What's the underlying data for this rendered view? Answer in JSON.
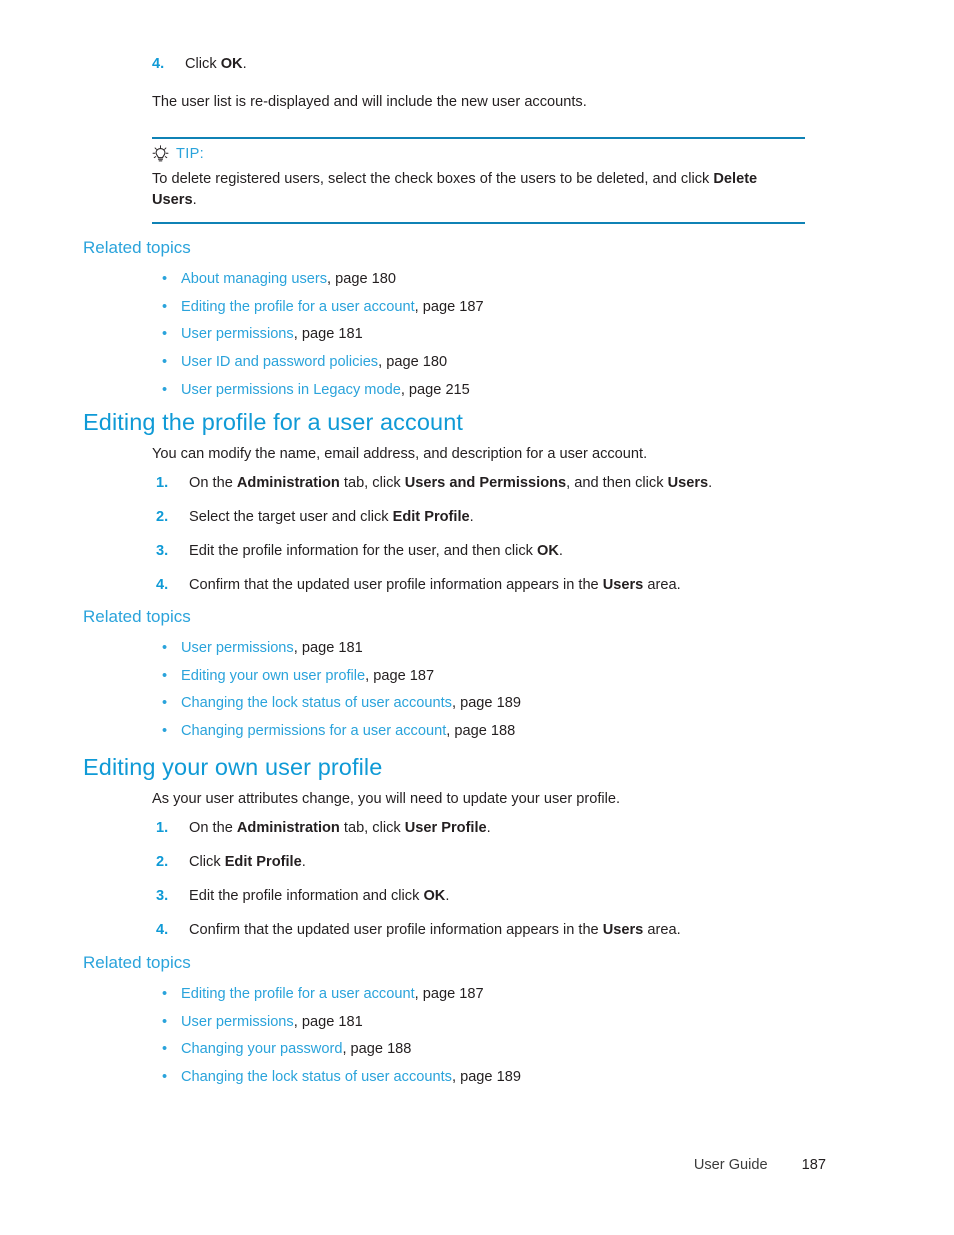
{
  "document": {
    "footer_label": "User Guide",
    "page_number": "187"
  },
  "colors": {
    "heading_blue": "#0f9ad6",
    "link_blue": "#2aa3db",
    "rule_blue": "#0f82b5",
    "body_black": "#231f20"
  },
  "top_step": {
    "number": "4.",
    "text_before": "Click ",
    "text_bold": "OK",
    "text_after": "."
  },
  "intro_paragraph": "The user list is re-displayed and will include the new user accounts.",
  "tip": {
    "icon": "lightbulb-icon",
    "label": "TIP:",
    "text_before": "To delete registered users, select the check boxes of the users to be deleted, and click ",
    "text_bold": "Delete Users",
    "text_after": "."
  },
  "related_topics_1": {
    "heading": "Related topics",
    "items": [
      {
        "bullet": "•",
        "link": "About managing users",
        "page": ", page 180"
      },
      {
        "bullet": "•",
        "link": "Editing the profile for a user account",
        "page": ", page 187"
      },
      {
        "bullet": "•",
        "link": "User permissions",
        "page": ", page 181"
      },
      {
        "bullet": "•",
        "link": "User ID and password policies",
        "page": ", page 180"
      },
      {
        "bullet": "•",
        "link": "User permissions in Legacy mode",
        "page": ", page 215"
      }
    ]
  },
  "section_edit_profile_user_account": {
    "heading": "Editing the profile for a user account",
    "intro": "You can modify the name, email address, and description for a user account.",
    "steps": [
      {
        "number": "1.",
        "parts": [
          {
            "text": "On the ",
            "bold": false
          },
          {
            "text": "Administration",
            "bold": true
          },
          {
            "text": " tab, click ",
            "bold": false
          },
          {
            "text": "Users and Permissions",
            "bold": true
          },
          {
            "text": ", and then click ",
            "bold": false
          },
          {
            "text": "Users",
            "bold": true
          },
          {
            "text": ".",
            "bold": false
          }
        ]
      },
      {
        "number": "2.",
        "parts": [
          {
            "text": "Select the target user and click ",
            "bold": false
          },
          {
            "text": "Edit Profile",
            "bold": true
          },
          {
            "text": ".",
            "bold": false
          }
        ]
      },
      {
        "number": "3.",
        "parts": [
          {
            "text": "Edit the profile information for the user, and then click ",
            "bold": false
          },
          {
            "text": "OK",
            "bold": true
          },
          {
            "text": ".",
            "bold": false
          }
        ]
      },
      {
        "number": "4.",
        "parts": [
          {
            "text": "Confirm that the updated user profile information appears in the ",
            "bold": false
          },
          {
            "text": "Users",
            "bold": true
          },
          {
            "text": " area.",
            "bold": false
          }
        ]
      }
    ]
  },
  "related_topics_2": {
    "heading": "Related topics",
    "items": [
      {
        "bullet": "•",
        "link": "User permissions",
        "page": ", page 181"
      },
      {
        "bullet": "•",
        "link": "Editing your own user profile",
        "page": ", page 187"
      },
      {
        "bullet": "•",
        "link": "Changing the lock status of user accounts",
        "page": ", page 189"
      },
      {
        "bullet": "•",
        "link": "Changing permissions for a user account",
        "page": ", page 188"
      }
    ]
  },
  "section_edit_own_profile": {
    "heading": "Editing your own user profile",
    "intro": "As your user attributes change, you will need to update your user profile.",
    "steps": [
      {
        "number": "1.",
        "parts": [
          {
            "text": "On the ",
            "bold": false
          },
          {
            "text": "Administration",
            "bold": true
          },
          {
            "text": " tab, click ",
            "bold": false
          },
          {
            "text": "User Profile",
            "bold": true
          },
          {
            "text": ".",
            "bold": false
          }
        ]
      },
      {
        "number": "2.",
        "parts": [
          {
            "text": "Click ",
            "bold": false
          },
          {
            "text": "Edit Profile",
            "bold": true
          },
          {
            "text": ".",
            "bold": false
          }
        ]
      },
      {
        "number": "3.",
        "parts": [
          {
            "text": "Edit the profile information and click ",
            "bold": false
          },
          {
            "text": "OK",
            "bold": true
          },
          {
            "text": ".",
            "bold": false
          }
        ]
      },
      {
        "number": "4.",
        "parts": [
          {
            "text": "Confirm that the updated user profile information appears in the ",
            "bold": false
          },
          {
            "text": "Users",
            "bold": true
          },
          {
            "text": " area.",
            "bold": false
          }
        ]
      }
    ]
  },
  "related_topics_3": {
    "heading": "Related topics",
    "items": [
      {
        "bullet": "•",
        "link": "Editing the profile for a user account",
        "page": ", page 187"
      },
      {
        "bullet": "•",
        "link": "User permissions",
        "page": ", page 181"
      },
      {
        "bullet": "•",
        "link": "Changing your password",
        "page": ", page 188"
      },
      {
        "bullet": "•",
        "link": "Changing the lock status of user accounts",
        "page": ", page 189"
      }
    ]
  }
}
